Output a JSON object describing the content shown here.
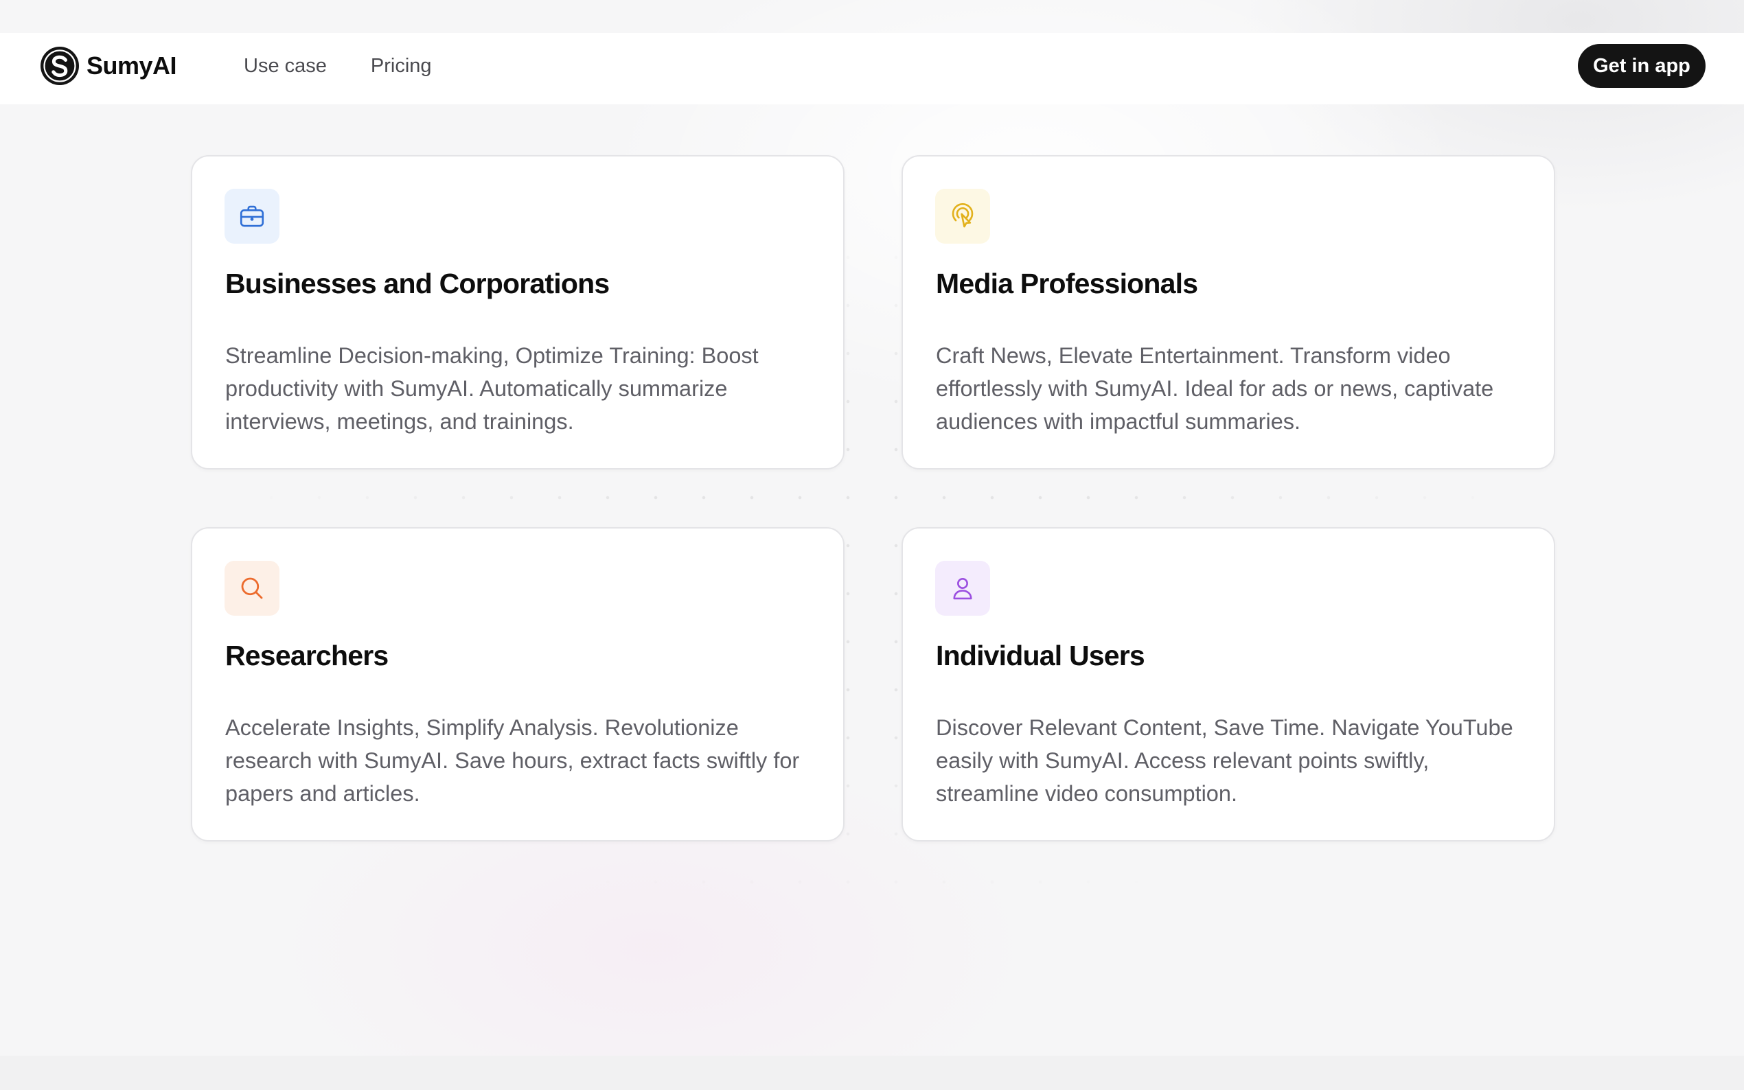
{
  "header": {
    "brand": "SumyAI",
    "nav": [
      {
        "label": "Use case"
      },
      {
        "label": "Pricing"
      }
    ],
    "cta_label": "Get in app"
  },
  "cards": [
    {
      "title": "Businesses and Corporations",
      "description": "Streamline Decision-making, Optimize Training: Boost productivity with SumyAI. Automatically summarize interviews, meetings, and trainings.",
      "icon": "briefcase-icon",
      "accent": "#2f6fd6",
      "tint": "#eaf2fd"
    },
    {
      "title": "Media Professionals",
      "description": "Craft News, Elevate Entertainment. Transform video effortlessly with SumyAI. Ideal for ads or news, captivate audiences with impactful summaries.",
      "icon": "touch-cursor-icon",
      "accent": "#e2b11c",
      "tint": "#fdf8e4"
    },
    {
      "title": "Researchers",
      "description": "Accelerate Insights, Simplify Analysis. Revolutionize research with SumyAI. Save hours, extract facts swiftly for papers and articles.",
      "icon": "search-icon",
      "accent": "#ec6b2d",
      "tint": "#fdf0e7"
    },
    {
      "title": "Individual Users",
      "description": "Discover Relevant Content, Save Time. Navigate YouTube easily with SumyAI. Access relevant points swiftly, streamline video consumption.",
      "icon": "user-icon",
      "accent": "#9b4fe0",
      "tint": "#f4ecfd"
    }
  ]
}
